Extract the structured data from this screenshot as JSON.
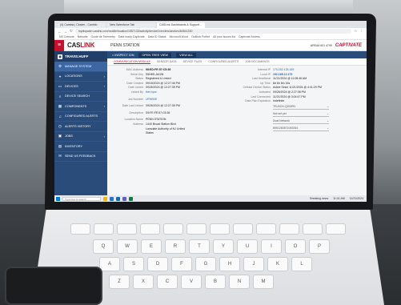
{
  "browser": {
    "tabs": [
      "(4) Cambia | Cluster - Cambio",
      "New Salesforce Tab",
      "CASLink Dashboards & Support..."
    ],
    "url": "mydispatch.caslink.com/mobile/location/1557130/activity/deviceOverview/devices/84541330",
    "bookmarks": [
      "NS Console",
      "Netsuite",
      "Guide de Telemetry",
      "Data ready Captivate",
      "Data ID Status",
      "Microsoft Word",
      "Outlook Portlet",
      "All your issues list",
      "Captivate Access"
    ]
  },
  "app": {
    "logo_main": "CAS",
    "logo_accent": "LINK",
    "location": "PENN STATION",
    "account": "AREA# 601 4799",
    "brand": "CAPTIVATE"
  },
  "sidebar": {
    "user": "TRAVIS.HUFF",
    "items": [
      {
        "label": "MANAGE SYSTEM",
        "icon": "gear-icon"
      },
      {
        "label": "LOCATIONS",
        "icon": "pin-icon"
      },
      {
        "label": "DEVICES",
        "icon": "monitor-icon"
      },
      {
        "label": "DEVICE SEARCH",
        "icon": "search-icon"
      },
      {
        "label": "COMPONENTS",
        "icon": "grid-icon"
      },
      {
        "label": "CONFIGURED ALERTS",
        "icon": "bell-icon"
      },
      {
        "label": "ALERTS HISTORY",
        "icon": "history-icon"
      },
      {
        "label": "JOBS",
        "icon": "briefcase-icon"
      },
      {
        "label": "INVENTORY",
        "icon": "box-icon"
      },
      {
        "label": "SEND US FEEDBACK",
        "icon": "chat-icon"
      }
    ]
  },
  "subheader": {
    "crumb": "< INSPECT ION",
    "btn1": "OPEN TREE VIEW",
    "btn2": "VIEW ALL"
  },
  "tabs": [
    "COMMUNICATION MODULE",
    "SENSOR DATA",
    "DEVICE FILES",
    "CONFIGURED ALERTS",
    "JOB DOCUMENTS"
  ],
  "details": {
    "left": [
      {
        "k": "MAC Address",
        "v": "98:ED:FE:57:C5:36"
      },
      {
        "k": "Serial Key",
        "v": "S5H8S-JAGW"
      },
      {
        "k": "Status",
        "v": "Registered & Linked"
      },
      {
        "k": "Date Created",
        "v": "09/18/2024 @ 12:27:46 PM"
      },
      {
        "k": "Date Linked",
        "v": "09/26/2024 @ 12:27:35 PM"
      },
      {
        "k": "Linked By",
        "v": "thet.hpor"
      },
      {
        "k": "Job Number",
        "v": "UPW90E"
      },
      {
        "k": "Date Last Linked",
        "v": "09/26/2024 @ 12:27:35 PM"
      },
      {
        "k": "Description",
        "v": "S9:FE:FE:57:C5:36"
      },
      {
        "k": "Location Name",
        "v": "PENN STATION"
      },
      {
        "k": "Address",
        "v": "1440 Broad Station Blvd Lansdale Authority of NJ United States"
      }
    ],
    "right": [
      {
        "k": "Internal IP",
        "v": "173.252.125.169"
      },
      {
        "k": "Local IP",
        "v": "192.168.12.175"
      },
      {
        "k": "Last Heartbeat",
        "v": "11/21/2024 @ 11:08:46 AM"
      },
      {
        "k": "Up Time",
        "v": "8d 6h 5m 16s"
      },
      {
        "k": "Cellular Device Status",
        "v": "Active Since 11/21/2024 @ 4:41:29 PM"
      },
      {
        "k": "Activated",
        "v": "09/26/2024 @ 2:27:38 PM"
      },
      {
        "k": "Last Connected",
        "v": "11/21/2024 @ 3:04:47 PM"
      },
      {
        "k": "Data Plan Expiration",
        "v": "Indefinite"
      }
    ],
    "selects": [
      {
        "label": "Hardware Variant",
        "value": "TELBOX-Q200RV"
      },
      {
        "label": "Firmware",
        "value": "Not set yet"
      },
      {
        "label": "Connection",
        "value": "Dual Network"
      },
      {
        "label": "SIM",
        "value": "8901260871000264"
      }
    ]
  },
  "taskbar": {
    "search": "Type here to search",
    "weather": "Breaking news",
    "time": "11:41 AM",
    "date": "11/21/2024"
  },
  "keyboard": {
    "row1": [
      "Q",
      "W",
      "E",
      "R",
      "T",
      "Y",
      "U",
      "I",
      "O",
      "P"
    ],
    "row2": [
      "A",
      "S",
      "D",
      "F",
      "G",
      "H",
      "J",
      "K",
      "L"
    ],
    "row3": [
      "Z",
      "X",
      "C",
      "V",
      "B",
      "N",
      "M"
    ]
  }
}
